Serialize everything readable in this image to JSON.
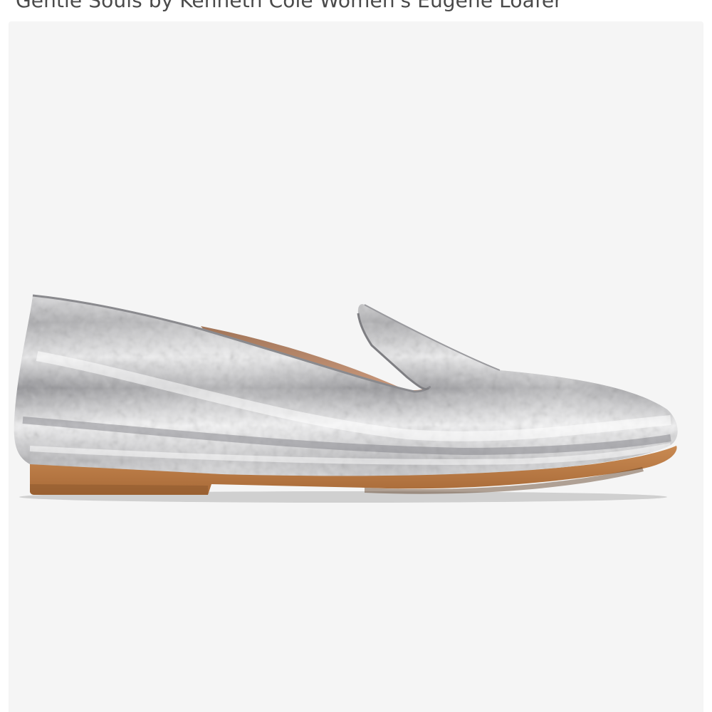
{
  "product": {
    "title": "Gentle Souls by Kenneth Cole Women's Eugene Loafer"
  },
  "image": {
    "alt": "Gentle Souls by Kenneth Cole Women's Eugene Loafer",
    "background_color": "#f5f5f5",
    "upper_color": "#c9c9cb",
    "sole_color": "#b87a44"
  }
}
